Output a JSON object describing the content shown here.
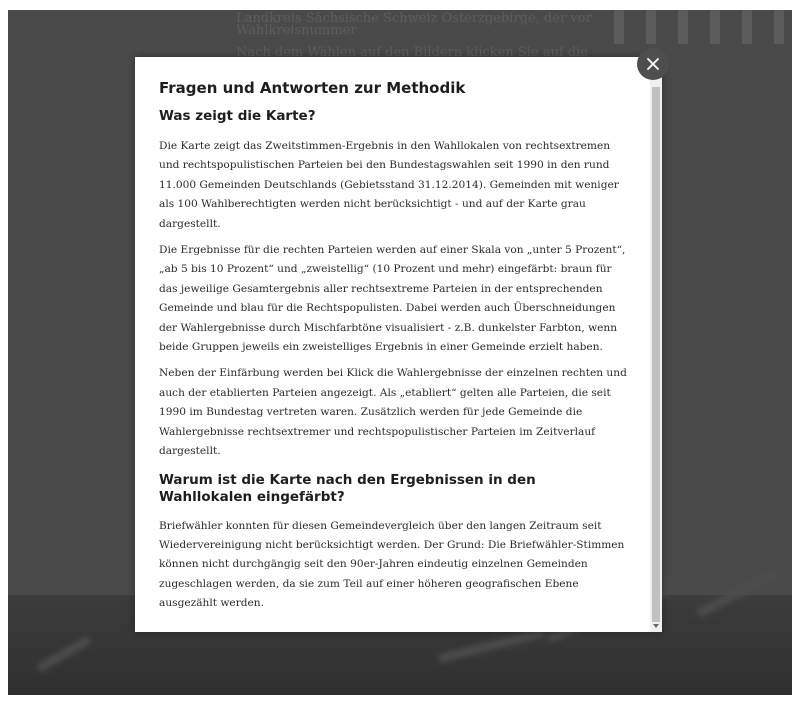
{
  "background": {
    "text_lines": [
      "Landkreis Sächsische Schweiz Osterzgebirge, der vor",
      "Wahlkreisnummer",
      "Nach dem Wählen auf den Bildern klicken Sie auf die"
    ]
  },
  "modal": {
    "title": "Fragen und Antworten zur Methodik",
    "sections": [
      {
        "heading": "Was zeigt die Karte?",
        "paragraphs": [
          "Die Karte zeigt das Zweitstimmen-Ergebnis in den Wahllokalen von rechtsextremen und rechtspopulistischen Parteien bei den Bundestagswahlen seit 1990 in den rund 11.000 Gemeinden Deutschlands (Gebietsstand 31.12.2014). Gemeinden mit weniger als 100 Wahlberechtigten werden nicht berücksichtigt - und auf der Karte grau dargestellt.",
          "Die Ergebnisse für die rechten Parteien werden auf einer Skala von „unter 5 Prozent“, „ab 5 bis 10 Prozent“ und „zweistellig“ (10 Prozent und mehr) eingefärbt: braun für das jeweilige Gesamtergebnis aller rechtsextreme Parteien in der entsprechenden Gemeinde und blau für die Rechtspopulisten. Dabei werden auch Überschneidungen der Wahlergebnisse durch Mischfarbtöne visualisiert - z.B. dunkelster Farbton, wenn beide Gruppen jeweils ein zweistelliges Ergebnis in einer Gemeinde erzielt haben.",
          "Neben der Einfärbung werden bei Klick die Wahlergebnisse der einzelnen rechten und auch der etablierten Parteien angezeigt. Als „etabliert“ gelten alle Parteien, die seit 1990 im Bundestag vertreten waren. Zusätzlich werden für jede Gemeinde die Wahlergebnisse rechtsextremer und rechtspopulistischer Parteien im Zeitverlauf dargestellt."
        ]
      },
      {
        "heading": "Warum ist die Karte nach den Ergebnissen in den Wahllokalen eingefärbt?",
        "paragraphs": [
          "Briefwähler konnten für diesen Gemeindevergleich über den langen Zeitraum seit Wiedervereinigung nicht berücksichtigt werden. Der Grund: Die Briefwähler-Stimmen können nicht durchgängig seit den 90er-Jahren eindeutig einzelnen Gemeinden zugeschlagen werden, da sie zum Teil auf einer höheren geografischen Ebene ausgezählt werden."
        ]
      }
    ],
    "close_icon": "close-icon"
  },
  "colors": {
    "overlay": "#4a4a4a",
    "close_button": "#4e4e4e",
    "modal_background": "#ffffff"
  }
}
